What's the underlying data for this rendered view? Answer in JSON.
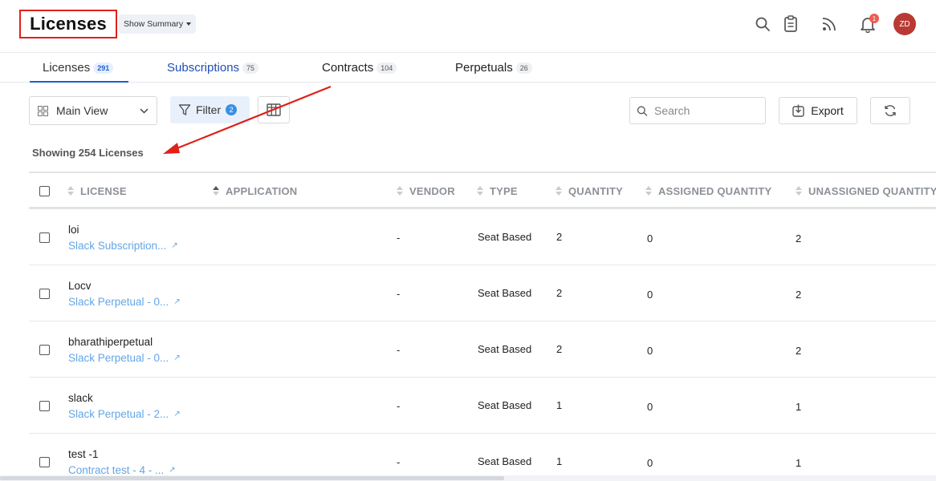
{
  "header": {
    "title": "Licenses",
    "summary_label": "Show Summary",
    "notification_count": "1",
    "avatar_initials": "ZD"
  },
  "tabs": [
    {
      "label": "Licenses",
      "count": "291"
    },
    {
      "label": "Subscriptions",
      "count": "75"
    },
    {
      "label": "Contracts",
      "count": "104"
    },
    {
      "label": "Perpetuals",
      "count": "26"
    }
  ],
  "toolbar": {
    "view_label": "Main View",
    "filter_label": "Filter",
    "filter_count": "2",
    "search_placeholder": "Search",
    "export_label": "Export"
  },
  "showing_text": "Showing 254 Licenses",
  "table": {
    "columns": [
      "LICENSE",
      "APPLICATION",
      "VENDOR",
      "TYPE",
      "QUANTITY",
      "ASSIGNED QUANTITY",
      "UNASSIGNED QUANTITY"
    ],
    "rows": [
      {
        "name": "loi",
        "link": "Slack Subscription...",
        "vendor": "-",
        "type": "Seat Based",
        "quantity": "2",
        "assigned": "0",
        "unassigned": "2"
      },
      {
        "name": "Locv",
        "link": "Slack Perpetual - 0...",
        "vendor": "-",
        "type": "Seat Based",
        "quantity": "2",
        "assigned": "0",
        "unassigned": "2"
      },
      {
        "name": "bharathiperpetual",
        "link": "Slack Perpetual - 0...",
        "vendor": "-",
        "type": "Seat Based",
        "quantity": "2",
        "assigned": "0",
        "unassigned": "2"
      },
      {
        "name": "slack",
        "link": "Slack Perpetual - 2...",
        "vendor": "-",
        "type": "Seat Based",
        "quantity": "1",
        "assigned": "0",
        "unassigned": "1"
      },
      {
        "name": "test -1",
        "link": "Contract test - 4 - ...",
        "vendor": "-",
        "type": "Seat Based",
        "quantity": "1",
        "assigned": "0",
        "unassigned": "1"
      }
    ]
  },
  "colors": {
    "accent": "#1f5fd1",
    "link": "#63a6e6",
    "annotation": "#e0201b"
  }
}
